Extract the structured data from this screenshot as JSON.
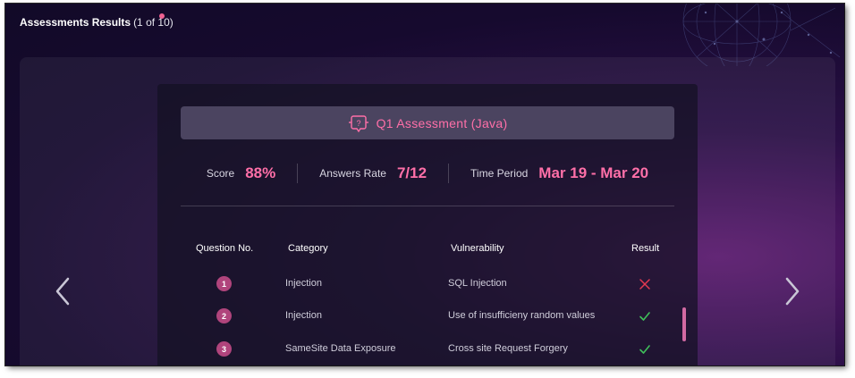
{
  "page": {
    "title": "Assessments Results",
    "count": "(1 of 10)"
  },
  "assessment": {
    "title": "Q1 Assessment (Java)",
    "icon": "question-bubble-icon"
  },
  "stats": [
    {
      "label": "Score",
      "value": "88%"
    },
    {
      "label": "Answers Rate",
      "value": "7/12"
    },
    {
      "label": "Time Period",
      "value": "Mar 19 - Mar 20"
    }
  ],
  "table": {
    "headers": [
      "Question No.",
      "Category",
      "Vulnerability",
      "Result"
    ],
    "rows": [
      {
        "num": "1",
        "category": "Injection",
        "vulnerability": "SQL Injection",
        "result": "incorrect"
      },
      {
        "num": "2",
        "category": "Injection",
        "vulnerability": "Use of insufficieny random values",
        "result": "correct"
      },
      {
        "num": "3",
        "category": "SameSite Data Exposure",
        "vulnerability": "Cross site Request Forgery",
        "result": "correct"
      }
    ]
  },
  "colors": {
    "accent": "#ff6fa8",
    "badge": "#b0447c",
    "correct": "#3fbf5a",
    "incorrect": "#e53950"
  },
  "nav": {
    "prev_icon": "chevron-left-icon",
    "next_icon": "chevron-right-icon"
  }
}
